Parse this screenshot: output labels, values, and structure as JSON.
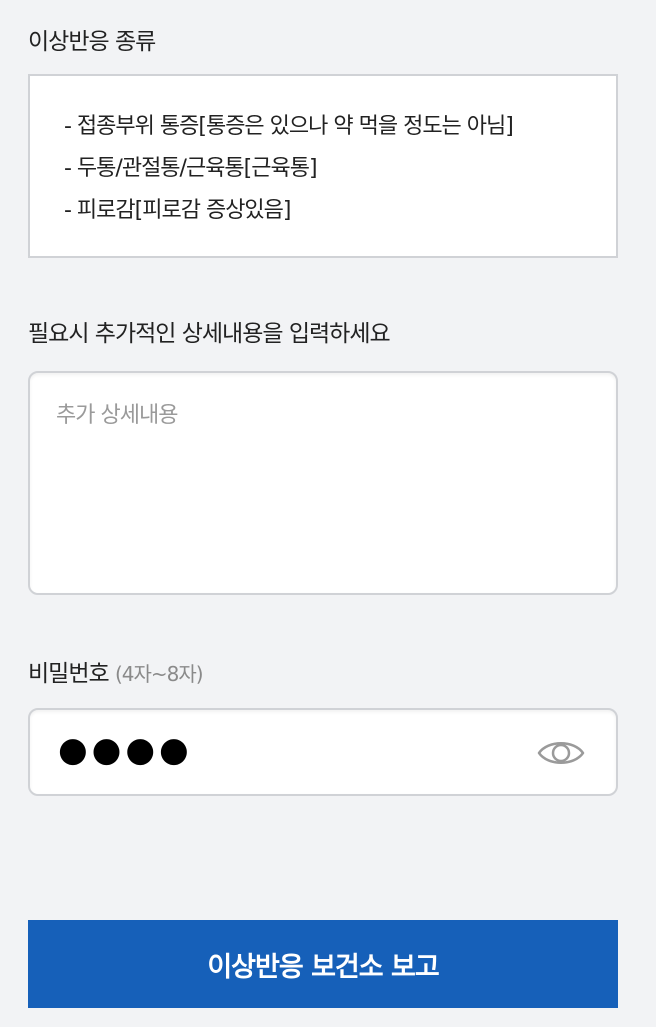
{
  "reaction": {
    "label": "이상반응 종류",
    "items": [
      "- 접종부위 통증[통증은 있으나 약 먹을 정도는 아님]",
      "- 두통/관절통/근육통[근육통]",
      "- 피로감[피로감 증상있음]"
    ]
  },
  "detail": {
    "label": "필요시 추가적인 상세내용을 입력하세요",
    "placeholder": "추가 상세내용",
    "value": ""
  },
  "password": {
    "label": "비밀번호",
    "hint": "(4자~8자)",
    "masked_value": "●●●●",
    "toggle_icon": "eye-icon"
  },
  "submit": {
    "label": "이상반응 보건소 보고",
    "color": "#1660b9"
  }
}
